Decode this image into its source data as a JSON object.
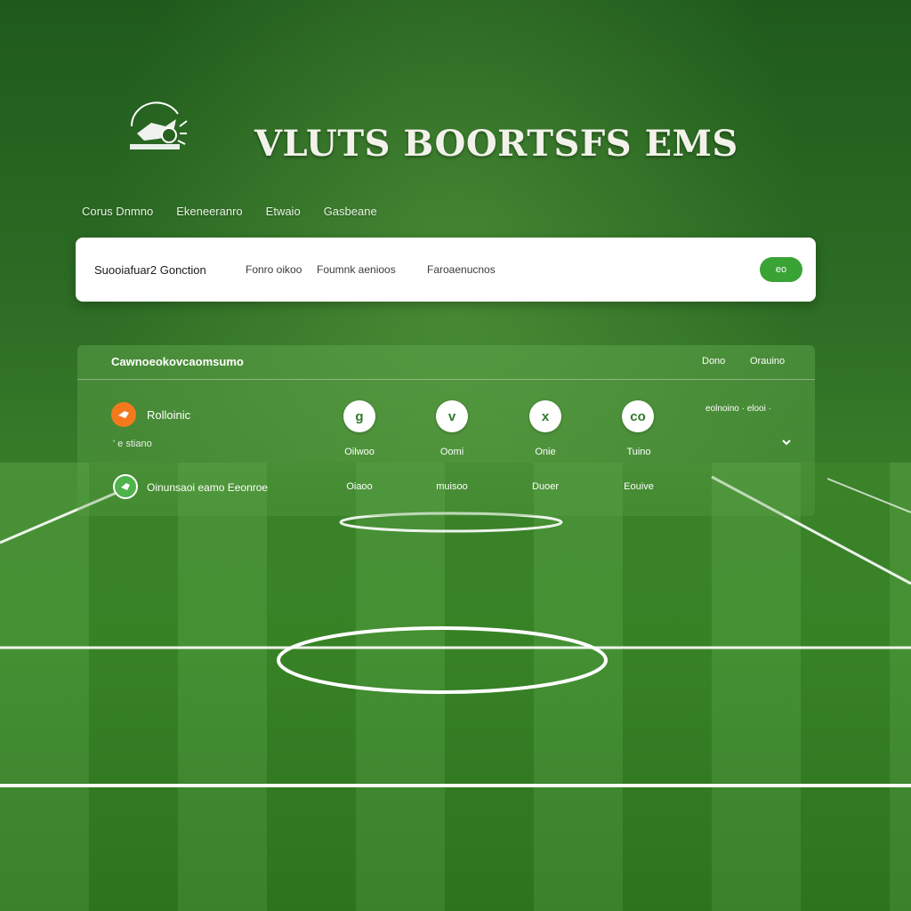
{
  "header": {
    "logo_icon": "soccer-ball-logo-icon",
    "title": "VLUTS BOORTSFS EMS"
  },
  "nav": {
    "items": [
      {
        "label": "Corus Dnmno"
      },
      {
        "label": "Ekeneeranro"
      },
      {
        "label": "Etwaio"
      },
      {
        "label": "Gasbeane"
      }
    ]
  },
  "search": {
    "filters": [
      {
        "label": "Suooiafuar2 Gonction"
      },
      {
        "label": "Fonro oikoo"
      },
      {
        "label": "Foumnk aenioos"
      },
      {
        "label": "Faroaenucnos"
      }
    ],
    "go_label": "eo"
  },
  "panel": {
    "title": "Cawnoeokovcaomsumo",
    "link_1": "Dono",
    "link_2": "Orauino",
    "teams": [
      {
        "name": "Rolloinic",
        "sub": "' e stiano",
        "badge_color": "#f27a1c"
      },
      {
        "name": "Oinunsaoi eamo Eeonroe",
        "badge_color": "#4db34a"
      }
    ],
    "columns": [
      {
        "icon": "g",
        "label": "Oilwoo",
        "value": "Oiaoo"
      },
      {
        "icon": "v",
        "label": "Oomi",
        "value": "muisoo"
      },
      {
        "icon": "x",
        "label": "Onie",
        "value": "Duoer"
      },
      {
        "icon": "co",
        "label": "Tuino",
        "value": "Eouive"
      }
    ],
    "meta": "eolnoino · elooi ·"
  },
  "colors": {
    "accent": "#3aa336",
    "orange": "#f27a1c",
    "pitch": "#3b8a28"
  }
}
